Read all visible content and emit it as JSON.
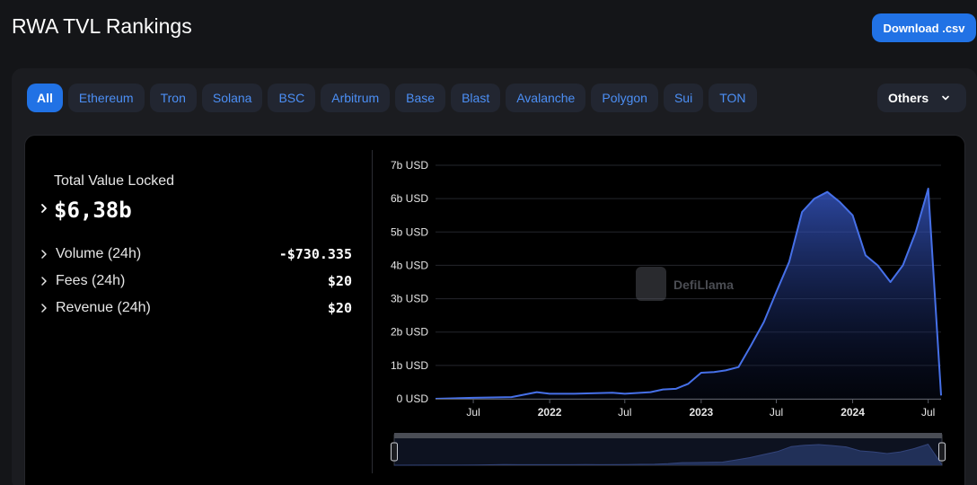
{
  "header": {
    "title": "RWA TVL Rankings",
    "download_label": "Download .csv"
  },
  "chains": {
    "tabs": [
      {
        "label": "All",
        "active": true
      },
      {
        "label": "Ethereum"
      },
      {
        "label": "Tron"
      },
      {
        "label": "Solana"
      },
      {
        "label": "BSC"
      },
      {
        "label": "Arbitrum"
      },
      {
        "label": "Base"
      },
      {
        "label": "Blast"
      },
      {
        "label": "Avalanche"
      },
      {
        "label": "Polygon"
      },
      {
        "label": "Sui"
      },
      {
        "label": "TON"
      }
    ],
    "others_label": "Others"
  },
  "stats": {
    "tvl_label": "Total Value Locked",
    "tvl_value": "$6,38b",
    "rows": [
      {
        "label": "Volume (24h)",
        "value": "-$730.335"
      },
      {
        "label": "Fees (24h)",
        "value": "$20"
      },
      {
        "label": "Revenue (24h)",
        "value": "$20"
      }
    ]
  },
  "watermark": "DefiLlama",
  "colors": {
    "accent": "#2172e5",
    "line": "#4670e8",
    "tab_text": "#4c8ff5"
  },
  "chart_data": {
    "type": "area",
    "y_ticks": [
      "7b USD",
      "6b USD",
      "5b USD",
      "4b USD",
      "3b USD",
      "2b USD",
      "1b USD",
      "0 USD"
    ],
    "y_values": [
      7,
      6,
      5,
      4,
      3,
      2,
      1,
      0
    ],
    "x_ticks": [
      "Jul",
      "2022",
      "Jul",
      "2023",
      "Jul",
      "2024",
      "Jul"
    ],
    "x_tick_dates": [
      "2021-07",
      "2022-01",
      "2022-07",
      "2023-01",
      "2023-07",
      "2024-01",
      "2024-07"
    ],
    "ylim": [
      0,
      7
    ],
    "y_unit": "b USD",
    "grid": true,
    "series": [
      {
        "x": [
          "2021-04",
          "2021-07",
          "2021-10",
          "2021-12",
          "2022-01",
          "2022-03",
          "2022-06",
          "2022-07",
          "2022-09",
          "2022-10",
          "2022-11",
          "2022-12",
          "2023-01",
          "2023-02",
          "2023-03",
          "2023-04",
          "2023-05",
          "2023-06",
          "2023-07",
          "2023-08",
          "2023-09",
          "2023-10",
          "2023-11",
          "2023-12",
          "2024-01",
          "2024-02",
          "2024-03",
          "2024-04",
          "2024-05",
          "2024-06",
          "2024-07",
          "2024-08"
        ],
        "values": [
          0.0,
          0.03,
          0.05,
          0.2,
          0.15,
          0.15,
          0.18,
          0.15,
          0.2,
          0.28,
          0.3,
          0.45,
          0.78,
          0.8,
          0.85,
          0.95,
          1.6,
          2.3,
          3.2,
          4.1,
          5.6,
          6.0,
          6.2,
          5.9,
          5.5,
          4.3,
          4.0,
          3.5,
          4.0,
          5.0,
          6.3,
          0.1
        ]
      }
    ]
  }
}
